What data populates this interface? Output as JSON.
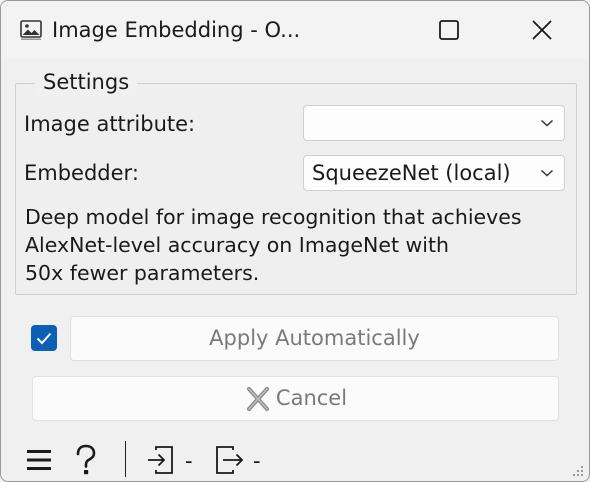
{
  "window": {
    "title": "Image Embedding - O...",
    "icon": "image-icon",
    "controls": [
      "maximize-icon",
      "close-icon"
    ]
  },
  "settings": {
    "legend": "Settings",
    "image_attribute_label": "Image attribute:",
    "image_attribute_value": "",
    "embedder_label": "Embedder:",
    "embedder_value": "SqueezeNet (local)",
    "description_lines": [
      "Deep model for image recognition that achieves",
      "AlexNet-level accuracy on ImageNet with",
      "50x fewer parameters."
    ]
  },
  "controls": {
    "apply_auto_checked": true,
    "apply_label": "Apply Automatically",
    "cancel_label": "Cancel"
  },
  "statusbar": {
    "input_summary": "-",
    "output_summary": "-",
    "icons": [
      "menu-icon",
      "help-icon",
      "input-icon",
      "output-icon",
      "resize-grip-icon"
    ]
  },
  "colors": {
    "accent": "#0b5fb4",
    "window_bg": "#f0f0f0",
    "disabled_text": "#7a7a7a"
  }
}
